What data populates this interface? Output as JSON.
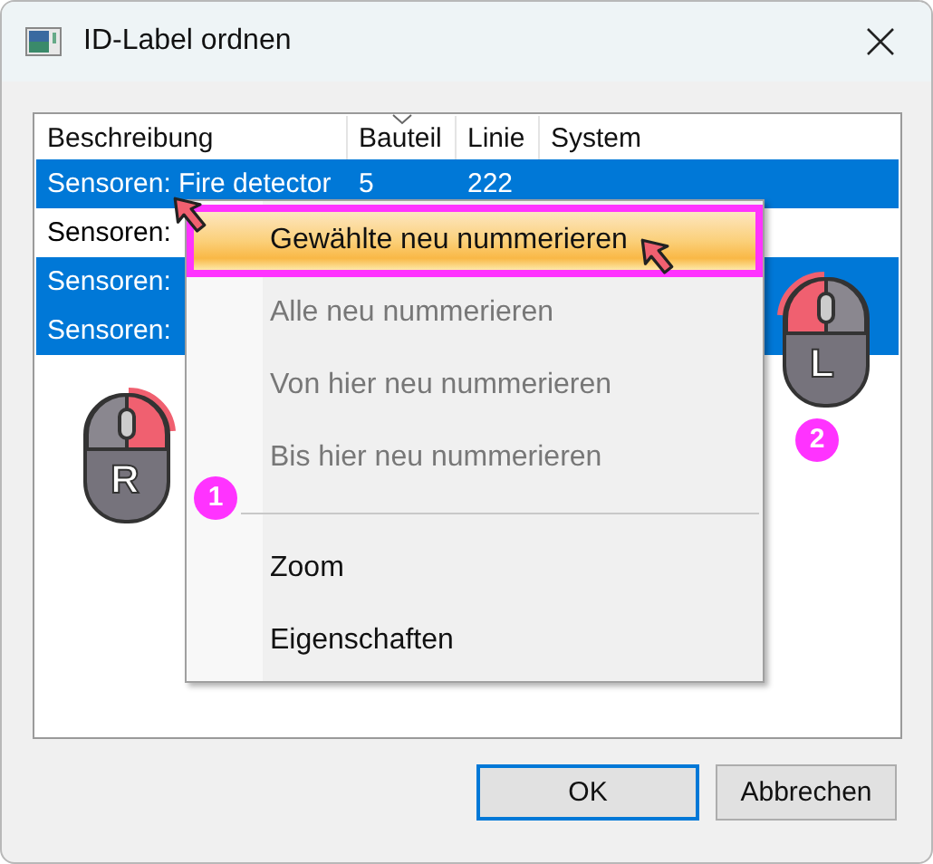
{
  "window": {
    "title": "ID-Label ordnen"
  },
  "table": {
    "columns": [
      {
        "label": "Beschreibung",
        "sorted": false
      },
      {
        "label": "Bauteil",
        "sorted": true
      },
      {
        "label": "Linie",
        "sorted": false
      },
      {
        "label": "System",
        "sorted": false
      }
    ],
    "rows": [
      {
        "selected": true,
        "cells": [
          "Sensoren: Fire detector",
          "5",
          "222"
        ]
      },
      {
        "selected": false,
        "cells": [
          "Sensoren:"
        ]
      },
      {
        "selected": true,
        "cells": [
          "Sensoren:"
        ]
      },
      {
        "selected": true,
        "cells": [
          "Sensoren:"
        ]
      }
    ]
  },
  "context_menu": {
    "items": [
      {
        "kind": "item",
        "label": "Gewählte neu nummerieren",
        "disabled": false,
        "selected": true
      },
      {
        "kind": "item",
        "label": "Alle neu nummerieren",
        "disabled": true,
        "selected": false
      },
      {
        "kind": "item",
        "label": "Von hier neu nummerieren",
        "disabled": true,
        "selected": false
      },
      {
        "kind": "item",
        "label": "Bis hier neu nummerieren",
        "disabled": true,
        "selected": false
      },
      {
        "kind": "separator"
      },
      {
        "kind": "item",
        "label": "Zoom",
        "disabled": false,
        "selected": false
      },
      {
        "kind": "item",
        "label": "Eigenschaften",
        "disabled": false,
        "selected": false
      }
    ]
  },
  "annotations": [
    {
      "kind": "right-click",
      "label": "R",
      "step": "1"
    },
    {
      "kind": "left-click",
      "label": "L",
      "step": "2"
    }
  ],
  "buttons": [
    {
      "label": "OK",
      "default": true
    },
    {
      "label": "Abbrechen",
      "default": false
    }
  ]
}
